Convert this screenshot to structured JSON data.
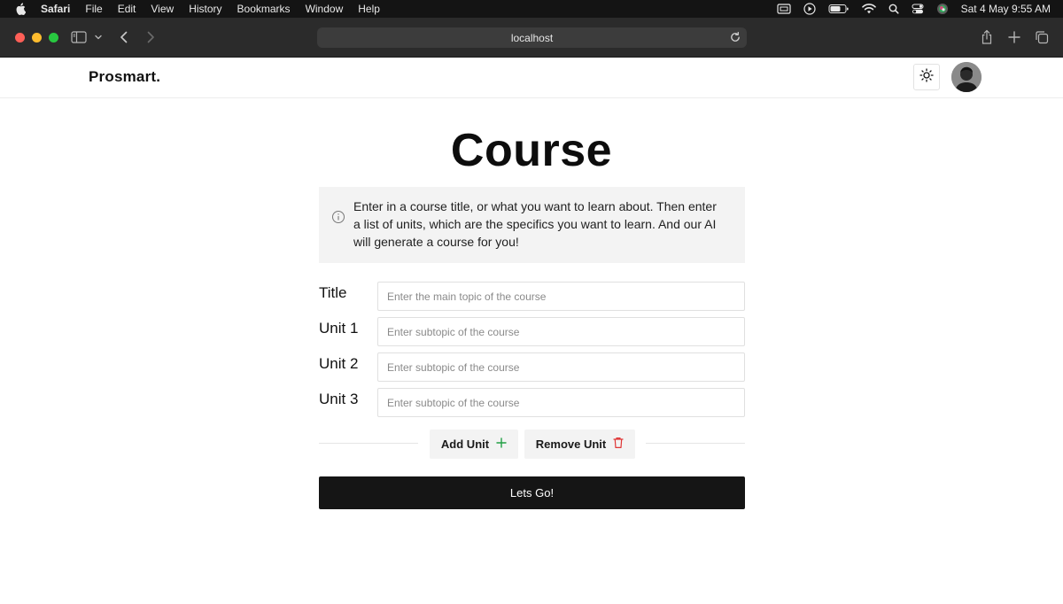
{
  "menubar": {
    "app": "Safari",
    "items": [
      "File",
      "Edit",
      "View",
      "History",
      "Bookmarks",
      "Window",
      "Help"
    ],
    "clock": "Sat 4 May  9:55 AM"
  },
  "browser": {
    "address": "localhost"
  },
  "nav": {
    "brand": "Prosmart."
  },
  "page": {
    "title": "Course",
    "info": "Enter in a course title, or what you want to learn about. Then enter a list of units, which are the specifics you want to learn. And our AI will generate a course for you!",
    "fields": [
      {
        "label": "Title",
        "placeholder": "Enter the main topic of the course"
      },
      {
        "label": "Unit 1",
        "placeholder": "Enter subtopic of the course"
      },
      {
        "label": "Unit 2",
        "placeholder": "Enter subtopic of the course"
      },
      {
        "label": "Unit 3",
        "placeholder": "Enter subtopic of the course"
      }
    ],
    "add_unit": "Add Unit",
    "remove_unit": "Remove Unit",
    "submit": "Lets Go!"
  },
  "colors": {
    "accent_add": "#22a045",
    "accent_remove": "#e03535",
    "submit_bg": "#151515"
  }
}
